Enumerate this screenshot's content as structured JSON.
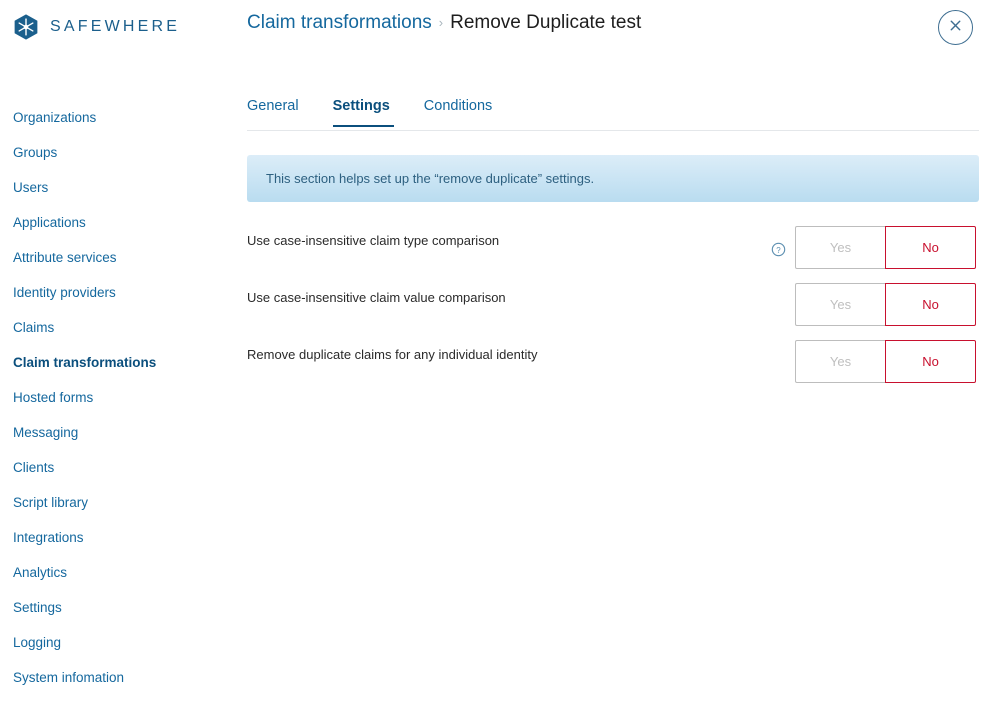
{
  "brand": {
    "name": "SAFEWHERE",
    "logo_icon": "snowflake-hexagon-icon",
    "color": "#1b5f8c"
  },
  "header": {
    "breadcrumb": {
      "parent": "Claim transformations",
      "separator": "›",
      "current": "Remove Duplicate test"
    },
    "close_icon": "close-circle-icon"
  },
  "sidebar": {
    "items": [
      {
        "label": "Organizations",
        "active": false
      },
      {
        "label": "Groups",
        "active": false
      },
      {
        "label": "Users",
        "active": false
      },
      {
        "label": "Applications",
        "active": false
      },
      {
        "label": "Attribute services",
        "active": false
      },
      {
        "label": "Identity providers",
        "active": false
      },
      {
        "label": "Claims",
        "active": false
      },
      {
        "label": "Claim transformations",
        "active": true
      },
      {
        "label": "Hosted forms",
        "active": false
      },
      {
        "label": "Messaging",
        "active": false
      },
      {
        "label": "Clients",
        "active": false
      },
      {
        "label": "Script library",
        "active": false
      },
      {
        "label": "Integrations",
        "active": false
      },
      {
        "label": "Analytics",
        "active": false
      },
      {
        "label": "Settings",
        "active": false
      },
      {
        "label": "Logging",
        "active": false
      },
      {
        "label": "System infomation",
        "active": false
      }
    ]
  },
  "main": {
    "tabs": [
      {
        "label": "General",
        "active": false
      },
      {
        "label": "Settings",
        "active": true
      },
      {
        "label": "Conditions",
        "active": false
      }
    ],
    "info_banner": {
      "text": "This section helps set up the “remove duplicate” settings."
    },
    "settings": [
      {
        "label": "Use case-insensitive claim type comparison",
        "has_help_icon": true,
        "help_icon": "help-circle-icon",
        "options": [
          {
            "label": "Yes",
            "selected": false
          },
          {
            "label": "No",
            "selected": true
          }
        ]
      },
      {
        "label": "Use case-insensitive claim value comparison",
        "has_help_icon": false,
        "help_icon": "",
        "options": [
          {
            "label": "Yes",
            "selected": false
          },
          {
            "label": "No",
            "selected": true
          }
        ]
      },
      {
        "label": "Remove duplicate claims for any individual identity",
        "has_help_icon": false,
        "help_icon": "",
        "options": [
          {
            "label": "Yes",
            "selected": false
          },
          {
            "label": "No",
            "selected": true
          }
        ]
      }
    ]
  },
  "colors": {
    "brand_blue": "#15689e",
    "dark_blue": "#0b4f7d",
    "selected_red": "#c8102e",
    "muted_gray": "#bfbfbf",
    "banner_top": "#dcedf8",
    "banner_bottom": "#b9dcf0"
  }
}
